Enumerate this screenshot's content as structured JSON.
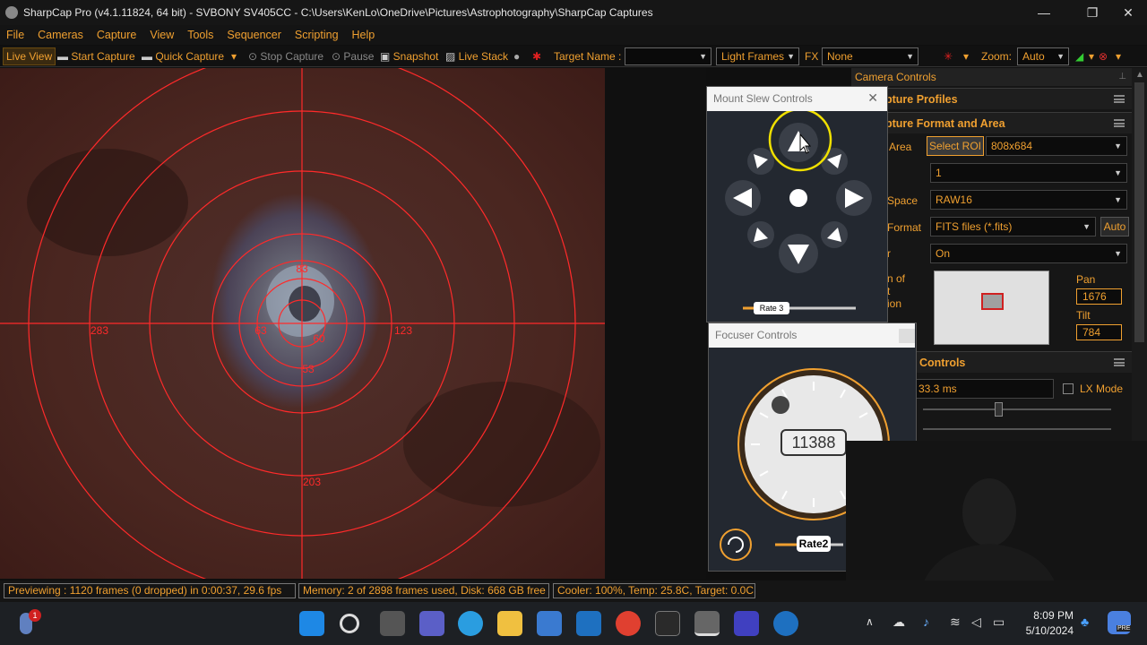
{
  "window": {
    "title": "SharpCap Pro (v4.1.11824, 64 bit) - SVBONY SV405CC - C:\\Users\\KenLo\\OneDrive\\Pictures\\Astrophotography\\SharpCap Captures",
    "minimize": "—",
    "maximize": "❐",
    "close": "✕"
  },
  "menu": [
    "File",
    "Cameras",
    "Capture",
    "View",
    "Tools",
    "Sequencer",
    "Scripting",
    "Help"
  ],
  "toolbar": {
    "live_view": "Live View",
    "start_capture": "Start Capture",
    "quick_capture": "Quick Capture",
    "stop_capture": "Stop Capture",
    "pause": "Pause",
    "snapshot": "Snapshot",
    "live_stack": "Live Stack",
    "target_name_label": "Target Name :",
    "target_name_value": "",
    "frame_type": "Light Frames",
    "fx_label": "FX",
    "fx_value": "None",
    "zoom_label": "Zoom:",
    "zoom_value": "Auto"
  },
  "reticle": {
    "labels": [
      "83",
      "283",
      "123",
      "203",
      "63",
      "60",
      "53"
    ],
    "color": "#ff2a2a"
  },
  "camera_controls": {
    "header": "Camera Controls",
    "capture_profiles": "pture Profiles",
    "capture_format_area": "pture Format and Area",
    "capture_area_label": "Area",
    "select_roi": "Select ROI",
    "resolution": "808x684",
    "binning": "1",
    "colour_space_label": "Space",
    "colour_space": "RAW16",
    "output_format_label": "Format",
    "output_format": "FITS files (*.fits)",
    "auto_button": "Auto",
    "debayer_label": "r",
    "debayer_value": "On",
    "position_label_1": "n of",
    "position_label_2": "t",
    "position_label_3": "ion",
    "pan_label": "Pan",
    "pan_value": "1676",
    "tilt_label": "Tilt",
    "tilt_value": "784",
    "camera_controls_section": "Controls",
    "exposure": "33.3 ms",
    "lx_mode": "LX Mode"
  },
  "mount_slew": {
    "title": "Mount Slew Controls",
    "rate": "Rate 3"
  },
  "focuser": {
    "title": "Focuser Controls",
    "position": "11388",
    "rate": "Rate2"
  },
  "status": {
    "preview": "Previewing : 1120 frames (0 dropped) in 0:00:37, 29.6 fps",
    "memory": "Memory: 2 of 2898 frames used, Disk: 668 GB free",
    "cooler": "Cooler: 100%, Temp: 25.8C, Target: 0.0C"
  },
  "taskbar": {
    "time": "8:09 PM",
    "date": "5/10/2024",
    "notification_badge": "1",
    "widget_label": "PRE"
  },
  "colors": {
    "accent": "#f0a030",
    "reticle": "#ff2a2a",
    "highlight": "#f0e000"
  }
}
